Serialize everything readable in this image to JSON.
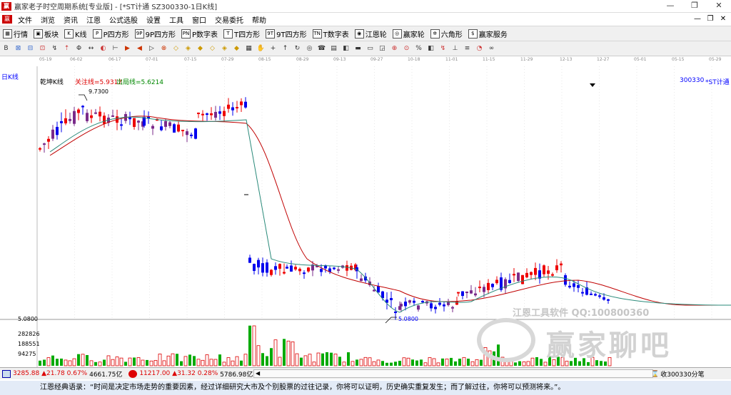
{
  "window": {
    "title": "赢家老子时空周期系统[专业版] - [*ST计通  SZ300330-1日K线]",
    "min": "—",
    "restore": "❐",
    "close": "✕"
  },
  "menu": [
    "文件",
    "浏览",
    "资讯",
    "江恩",
    "公式选股",
    "设置",
    "工具",
    "窗口",
    "交易委托",
    "帮助"
  ],
  "toolbar1": [
    {
      "icon": "grid-icon",
      "glyph": "▦",
      "label": "行情"
    },
    {
      "icon": "block-icon",
      "glyph": "▣",
      "label": "板块"
    },
    {
      "icon": "kline-icon",
      "glyph": "K",
      "label": "K线"
    },
    {
      "icon": "p-square-icon",
      "glyph": "P",
      "label": "P四方形"
    },
    {
      "icon": "9p-square-icon",
      "glyph": "9P",
      "label": "9P四方形"
    },
    {
      "icon": "pn-icon",
      "glyph": "PN",
      "label": "P数字表"
    },
    {
      "icon": "t-square-icon",
      "glyph": "T",
      "label": "T四方形"
    },
    {
      "icon": "9t-square-icon",
      "glyph": "9T",
      "label": "9T四方形"
    },
    {
      "icon": "tn-icon",
      "glyph": "TN",
      "label": "T数字表"
    },
    {
      "icon": "gann-wheel-icon",
      "glyph": "◉",
      "label": "江恩轮"
    },
    {
      "icon": "winner-wheel-icon",
      "glyph": "◎",
      "label": "赢家轮"
    },
    {
      "icon": "hexagon-icon",
      "glyph": "✲",
      "label": "六角形"
    },
    {
      "icon": "dollar-icon",
      "glyph": "$",
      "label": "赢家服务"
    }
  ],
  "toolbar2": [
    "B",
    "⊠",
    "⊟",
    "⊡",
    "↯",
    "⇡",
    "Φ",
    "↔",
    "◐",
    "⊢",
    "▶",
    "◀",
    "▷",
    "⊗",
    "◇",
    "◈",
    "◆",
    "◇",
    "◈",
    "◆",
    "▦",
    "✋",
    "+",
    "↑",
    "↻",
    "◎",
    "☎",
    "▤",
    "◧",
    "▬",
    "▭",
    "◲",
    "⊕",
    "⊙",
    "%",
    "◧",
    "↯",
    "⊥",
    "≡",
    "◔",
    "∞"
  ],
  "date_axis": [
    "05-19",
    "06-02",
    "06-17",
    "07-01",
    "07-15",
    "07-29",
    "08-15",
    "08-29",
    "09-13",
    "09-27",
    "10-18",
    "11-01",
    "11-15",
    "11-29",
    "12-13",
    "12-27",
    "05-01",
    "05-15",
    "05-29"
  ],
  "chart_label": "日K线",
  "indicator": {
    "name": "乾坤K线",
    "focus_line": "关注线=5.9312",
    "exit_line": "出局线=5.6214",
    "code": "300330",
    "stock": "*ST计通"
  },
  "annotations": {
    "high": "9.7300",
    "low": "5.0800"
  },
  "volume_axis": [
    "5.0800",
    "282826",
    "188551",
    "94275"
  ],
  "status": {
    "sh_index": "3285.88",
    "sh_change": "▲21.78 0.67%",
    "sh_amount": "4661.75亿",
    "sz_index": "11217.00",
    "sz_change": "▲31.32 0.28%",
    "sz_amount": "5786.98亿",
    "right_text": "收300330分笔"
  },
  "watermark": {
    "line1": "江恩工具软件  QQ:100800360",
    "line2": "赢家聊吧"
  },
  "quote": "江恩经典语录：“时间是决定市场走势的重要因素，经过详细研究大市及个别股票的过往记录，你将可以证明，历史确实重复发生；而了解过往，你将可以预测将来。”。",
  "colors": {
    "up": "#ee0000",
    "down": "#0000ee",
    "mid": "#7a2a8a",
    "ma_red": "#c00000",
    "ma_green": "#2a8a7a",
    "vol_up": "#dd0000",
    "vol_down": "#00aa00"
  }
}
